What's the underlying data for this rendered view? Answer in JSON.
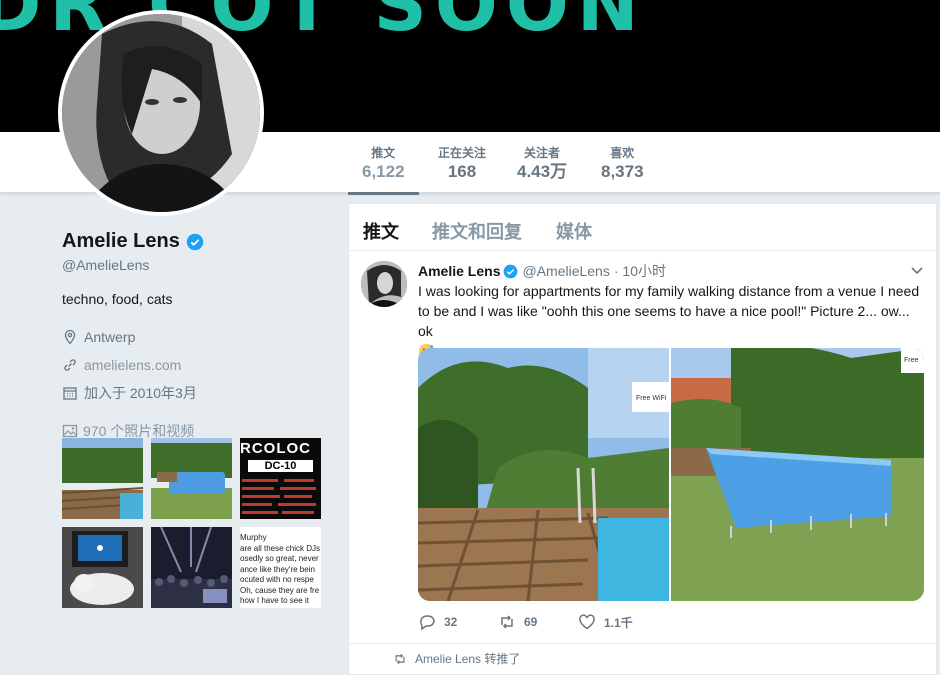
{
  "banner": {
    "text": "DR COT SOON"
  },
  "stats": [
    {
      "label": "推文",
      "value": "6,122"
    },
    {
      "label": "正在关注",
      "value": "168"
    },
    {
      "label": "关注者",
      "value": "4.43万"
    },
    {
      "label": "喜欢",
      "value": "8,373"
    }
  ],
  "profile": {
    "name": "Amelie Lens",
    "handle": "@AmelieLens",
    "bio": "techno, food, cats",
    "location": "Antwerp",
    "website": "amelielens.com",
    "joined": "加入于 2010年3月",
    "photos_label": "970 个照片和视频"
  },
  "thumbs": {
    "t3_title": "RCOLOC",
    "t3_sub": "DC-10",
    "t6_lines": [
      "Murphy",
      "are all these chick DJs",
      "osedly so great, never",
      "ance like they're bein",
      "ocuted with no respe",
      "Oh, cause they are fre",
      "how I have to see it"
    ]
  },
  "tabs": [
    "推文",
    "推文和回复",
    "媒体"
  ],
  "tweet": {
    "name": "Amelie Lens",
    "handle": "@AmelieLens",
    "time": "· 10小时",
    "text": "I was looking for appartments for my family walking distance from a venue I need to be and I was like \"oohh this one seems to have a nice pool!\" Picture 2... ow... ok",
    "media_label_1": "Free WiFi",
    "media_label_2": "Free",
    "replies": "32",
    "retweets": "69",
    "likes": "1.1千"
  },
  "next_tweet": {
    "retweeted_by": "Amelie Lens 转推了"
  },
  "colors": {
    "accent": "#1da1f2",
    "banner_text": "#1fbfa8",
    "muted": "#657786"
  }
}
